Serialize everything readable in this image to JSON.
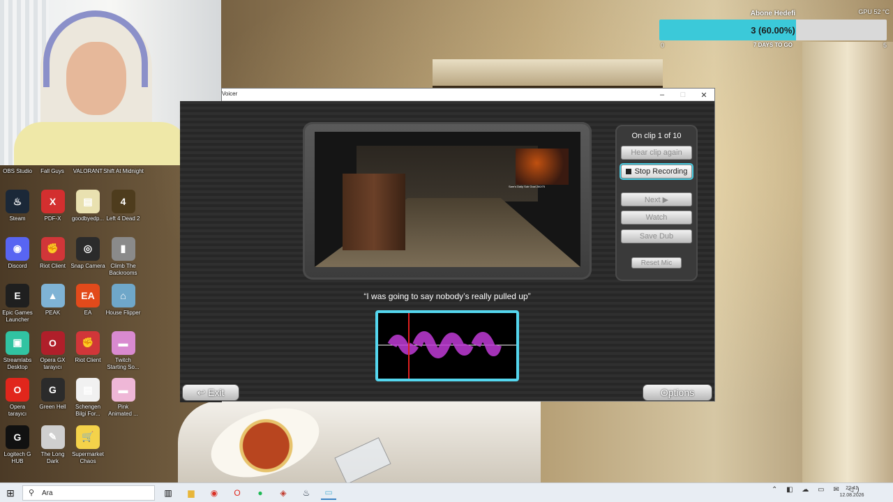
{
  "overlay": {
    "goal_title": "Abone Hedefi",
    "gpu_temp": "GPU 52 °C",
    "goal_value": "3 (60.00%)",
    "goal_progress_percent": 60,
    "goal_min": "0",
    "goal_days": "7 DAYS TO GO",
    "goal_max": "5"
  },
  "desktop": {
    "top_labels": [
      "OBS Studio",
      "Fall Guys",
      "VALORANT",
      "Shift At Midnight"
    ],
    "icons": [
      {
        "label": "Steam",
        "glyph": "♨",
        "color": "#1b2838"
      },
      {
        "label": "PDF-X",
        "glyph": "X",
        "color": "#d32f2f"
      },
      {
        "label": "goodbyedp...",
        "glyph": "▤",
        "color": "#e9e1b0"
      },
      {
        "label": "Left 4 Dead 2",
        "glyph": "4",
        "color": "#4e3c1d"
      },
      {
        "label": "Discord",
        "glyph": "◉",
        "color": "#5865f2"
      },
      {
        "label": "Riot Client",
        "glyph": "✊",
        "color": "#d13639"
      },
      {
        "label": "Snap Camera",
        "glyph": "◎",
        "color": "#2b2b2b"
      },
      {
        "label": "Climb The Backrooms",
        "glyph": "▮",
        "color": "#8a8a8a"
      },
      {
        "label": "Epic Games Launcher",
        "glyph": "E",
        "color": "#1f1f1f"
      },
      {
        "label": "PEAK",
        "glyph": "▲",
        "color": "#7fb3d5"
      },
      {
        "label": "EA",
        "glyph": "EA",
        "color": "#e24a1b"
      },
      {
        "label": "House Flipper",
        "glyph": "⌂",
        "color": "#6fa7c9"
      },
      {
        "label": "Streamlabs Desktop",
        "glyph": "▣",
        "color": "#31c3a2"
      },
      {
        "label": "Opera GX tarayıcı",
        "glyph": "O",
        "color": "#b01f2a"
      },
      {
        "label": "Riot Client",
        "glyph": "✊",
        "color": "#d13639"
      },
      {
        "label": "Twitch Starting So...",
        "glyph": "▬",
        "color": "#d98ad0"
      },
      {
        "label": "Opera tarayıcı",
        "glyph": "O",
        "color": "#e1261c"
      },
      {
        "label": "Green Hell",
        "glyph": "G",
        "color": "#2b2b2b"
      },
      {
        "label": "Schengen Bilgi For...",
        "glyph": "▤",
        "color": "#f1f1f1"
      },
      {
        "label": "Pink Animated ...",
        "glyph": "▬",
        "color": "#efb7d7"
      },
      {
        "label": "Logitech G HUB",
        "glyph": "G",
        "color": "#111111"
      },
      {
        "label": "The Long Dark",
        "glyph": "✎",
        "color": "#cfcfcf"
      },
      {
        "label": "Supermarket Chaos",
        "glyph": "🛒",
        "color": "#f4d24a"
      }
    ]
  },
  "window": {
    "title": "Voicer",
    "minimize": "–",
    "maximize": "□",
    "close": "✕",
    "clip_counter": "On clip 1 of 10",
    "buttons": {
      "hear_clip": "Hear clip again",
      "stop_recording": "Stop Recording",
      "next": "Next ▶",
      "watch": "Watch",
      "save_dub": "Save Dub",
      "reset_mic": "Reset Mic"
    },
    "subtitle": "“I was going to say nobody’s really pulled up”",
    "exit": "↩ Exit",
    "options": "Options",
    "video_overlay_text": "Sam's Daily Sub Goal 280/75"
  },
  "taskbar": {
    "start_icon": "windows-icon",
    "search_text": "Ara",
    "tray_icons": "⌃ ◧ ☁ ▭ ✉ ◁)",
    "time": "22:41",
    "date": "12.08.2026"
  }
}
